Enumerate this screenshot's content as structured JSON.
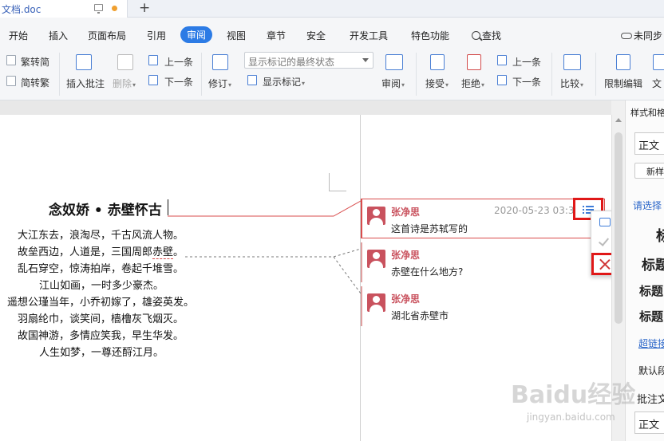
{
  "window": {
    "doc_tab_title": "文档.doc",
    "new_tab_symbol": "+"
  },
  "menu": {
    "items": [
      "开始",
      "插入",
      "页面布局",
      "引用",
      "审阅",
      "视图",
      "章节",
      "安全",
      "开发工具",
      "特色功能"
    ],
    "active": "审阅",
    "search_label": "查找",
    "sync_label": "未同步"
  },
  "ribbon": {
    "trad_to_simp": "繁转简",
    "simp_to_trad": "简转繁",
    "insert_comment": "插入批注",
    "delete": "删除",
    "prev": "上一条",
    "next": "下一条",
    "track_changes": "修订",
    "markup_select": "显示标记的最终状态",
    "show_markup": "显示标记",
    "review": "审阅",
    "accept": "接受",
    "reject": "拒绝",
    "prev2": "上一条",
    "next2": "下一条",
    "compare": "比较",
    "restrict_edit": "限制编辑",
    "document_more": "文"
  },
  "document": {
    "title": "念奴娇 • 赤壁怀古",
    "lines": [
      "大江东去，浪淘尽，千古风流人物。",
      "故垒西边，人道是，三国周郎赤壁。",
      "乱石穿空，惊涛拍岸，卷起千堆雪。",
      "江山如画，一时多少豪杰。",
      "遥想公瑾当年，小乔初嫁了，雄姿英发。",
      "羽扇纶巾，谈笑间，樯橹灰飞烟灭。",
      "故国神游，多情应笑我，早生华发。",
      "人生如梦，一尊还酹江月。"
    ],
    "line2_prefix": "故垒西边，人道是，三国周郎",
    "line2_highlight": "赤壁",
    "line2_suffix": "。"
  },
  "comments": [
    {
      "author": "张净思",
      "text": "这首诗是苏轼写的",
      "time": "2020-05-23 03:33"
    },
    {
      "author": "张净思",
      "text": "赤壁在什么地方?"
    },
    {
      "author": "张净思",
      "text": "湖北省赤壁市"
    }
  ],
  "comment_menu": {
    "reply": "答复",
    "resolve": "解决",
    "delete": "删除"
  },
  "right_panel": {
    "heading": "样式和格",
    "style_box": "正文",
    "new_style": "新样",
    "select_hint": "请选择",
    "h1": "标",
    "h2": "标题",
    "h3": "标题",
    "h4": "标题",
    "hyperlink": "超链接",
    "default_para": "默认段",
    "comment_text": "批注文",
    "style_box2": "正文"
  },
  "watermark": {
    "text": "Baidu经验",
    "url": "jingyan.baidu.com"
  }
}
